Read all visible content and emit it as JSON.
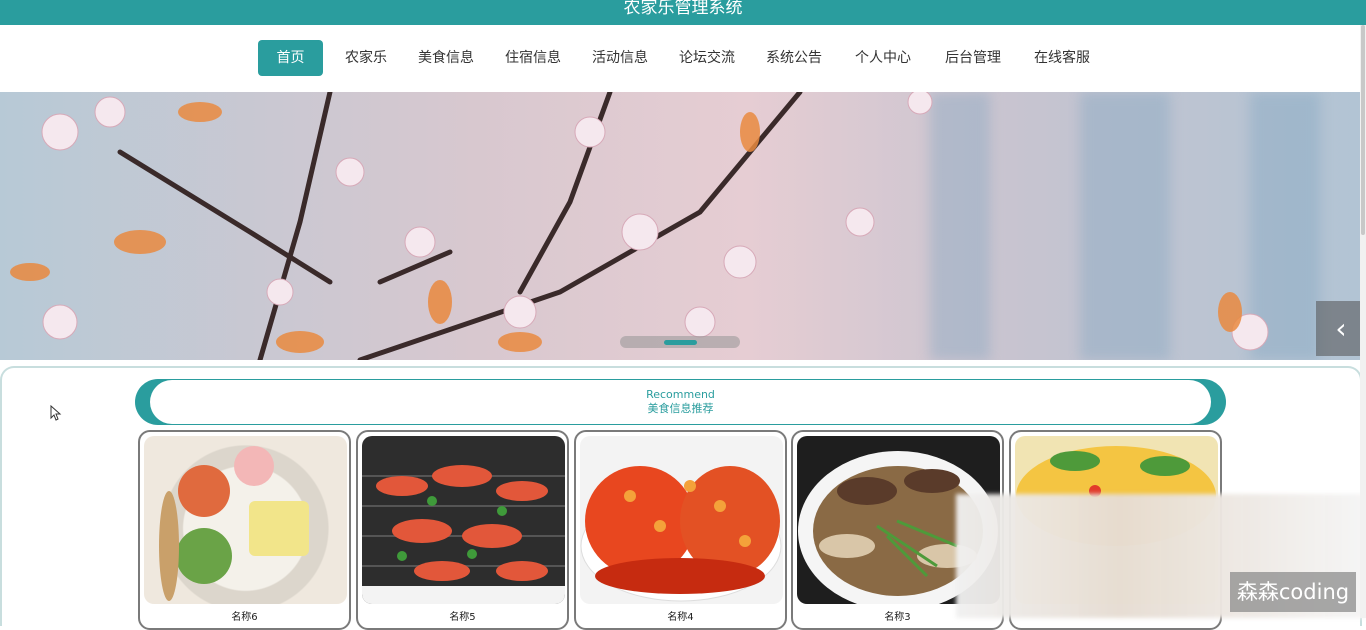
{
  "app": {
    "title": "农家乐管理系统"
  },
  "nav": {
    "items": [
      {
        "label": "首页"
      },
      {
        "label": "农家乐"
      },
      {
        "label": "美食信息"
      },
      {
        "label": "住宿信息"
      },
      {
        "label": "活动信息"
      },
      {
        "label": "论坛交流"
      },
      {
        "label": "系统公告"
      },
      {
        "label": "个人中心"
      },
      {
        "label": "后台管理"
      },
      {
        "label": "在线客服"
      }
    ],
    "active_index": 0
  },
  "banner": {
    "arrow": "chevron-left-icon"
  },
  "recommend": {
    "title_en": "Recommend",
    "title_cn": "美食信息推荐"
  },
  "cards": [
    {
      "name": "名称6"
    },
    {
      "name": "名称5"
    },
    {
      "name": "名称4"
    },
    {
      "name": "名称3"
    },
    {
      "name": ""
    }
  ],
  "watermark": "森森coding",
  "colors": {
    "accent": "#2a9d9e"
  }
}
